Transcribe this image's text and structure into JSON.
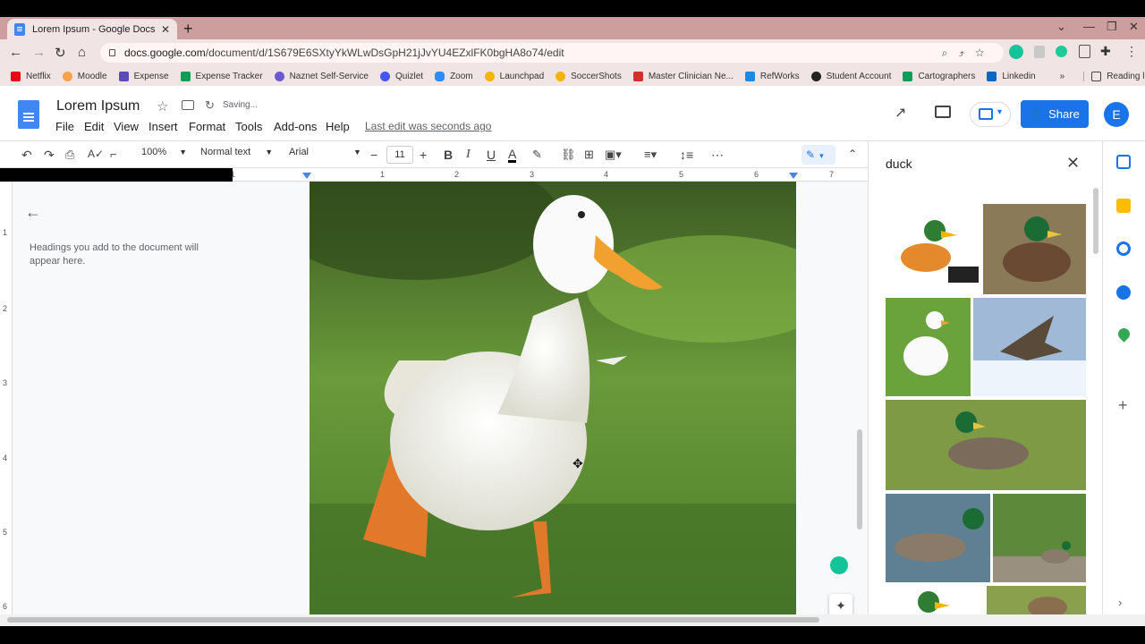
{
  "browser": {
    "tab_title": "Lorem Ipsum - Google Docs",
    "url_domain": "docs.google.com",
    "url_path": "/document/d/1S679E6SXtyYkWLwDsGpH21jJvYU4EZxlFK0bgHA8o74/edit",
    "bookmarks": [
      {
        "label": "Netflix",
        "color": "#e50914"
      },
      {
        "label": "Moodle",
        "color": "#ffffff"
      },
      {
        "label": "Expense",
        "color": "#5b4bb7"
      },
      {
        "label": "Expense Tracker",
        "color": "#0f9d58"
      },
      {
        "label": "Naznet Self-Service",
        "color": "#6a5acd"
      },
      {
        "label": "Quizlet",
        "color": "#4255ff"
      },
      {
        "label": "Zoom",
        "color": "#2d8cff"
      },
      {
        "label": "Launchpad",
        "color": "#f4b400"
      },
      {
        "label": "SoccerShots",
        "color": "#f4b400"
      },
      {
        "label": "Master Clinician Ne...",
        "color": "#d32f2f"
      },
      {
        "label": "RefWorks",
        "color": "#1e88e5"
      },
      {
        "label": "Student Account",
        "color": "#222222"
      },
      {
        "label": "Cartographers",
        "color": "#0f9d58"
      },
      {
        "label": "Linkedin",
        "color": "#0a66c2"
      }
    ],
    "reading_list": "Reading list",
    "more_bookmarks": "»"
  },
  "doc": {
    "title": "Lorem Ipsum",
    "status": "Saving...",
    "menus": [
      "File",
      "Edit",
      "View",
      "Insert",
      "Format",
      "Tools",
      "Add-ons",
      "Help"
    ],
    "last_edit": "Last edit was seconds ago",
    "share_label": "Share",
    "avatar_initial": "E"
  },
  "format_toolbar": {
    "zoom": "100%",
    "style": "Normal text",
    "font": "Arial",
    "font_size": "11"
  },
  "ruler_numbers": [
    "1",
    "1",
    "2",
    "3",
    "4",
    "5",
    "6",
    "7"
  ],
  "vertical_ruler_numbers": [
    "1",
    "2",
    "3",
    "4",
    "5",
    "6"
  ],
  "outline": {
    "empty_text": "Headings you add to the document will appear here."
  },
  "explore_panel": {
    "query": "duck"
  },
  "colors": {
    "accent": "#1a73e8",
    "tabstrip": "#cd9e9e",
    "toolbar": "#f1e4e4"
  }
}
